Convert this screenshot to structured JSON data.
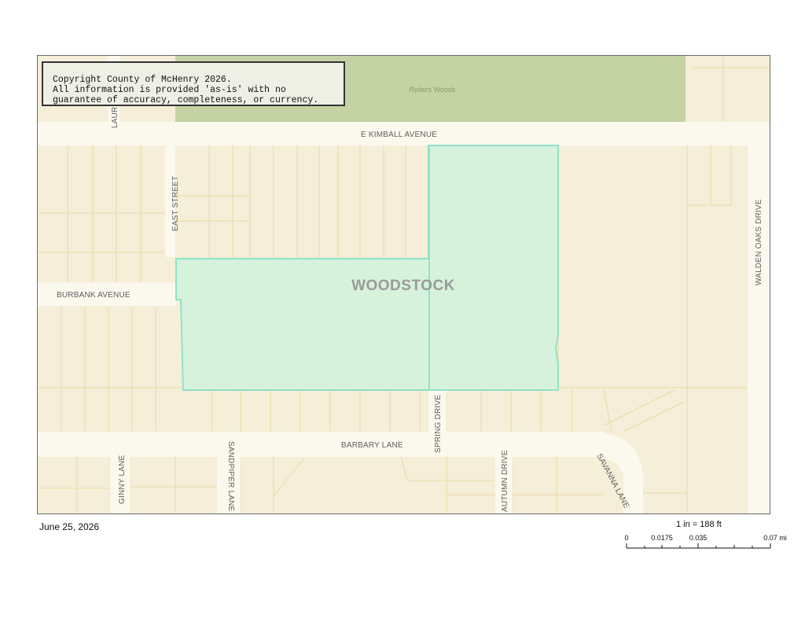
{
  "map": {
    "city_label": "WOODSTOCK",
    "park_label": "Ryders Woods",
    "streets": {
      "kimball": "E   KIMBALL AVENUE",
      "east_street": "EAST STREET",
      "laurel": "LAUREL AVENUE",
      "burbank": "BURBANK AVENUE",
      "walden": "WALDEN OAKS DRIVE",
      "barbary": "BARBARY LANE",
      "spring": "SPRING DRIVE",
      "ginny": "GINNY LANE",
      "sandpiper": "SANDPIPER LANE",
      "autumn": "AUTUMN DRIVE",
      "savanna": "SAVANNA LANE"
    },
    "colors": {
      "background": "#f5eed8",
      "parcel_lines": "#ecd9a6",
      "roads": "#fbf8ee",
      "park": "#c5d3a4",
      "highlight_fill": "#d6f2dc",
      "highlight_stroke": "#8fe3c9"
    }
  },
  "copyright": {
    "line1": "Copyright County of McHenry 2026.",
    "line2": "All information is provided 'as-is' with no",
    "line3": "guarantee of accuracy, completeness, or currency."
  },
  "footer": {
    "date": "June 25, 2026",
    "scale_text": "1 in = 188 ft",
    "scale_ticks": [
      "0",
      "0.0175",
      "0.035",
      "0.07 mi"
    ]
  }
}
